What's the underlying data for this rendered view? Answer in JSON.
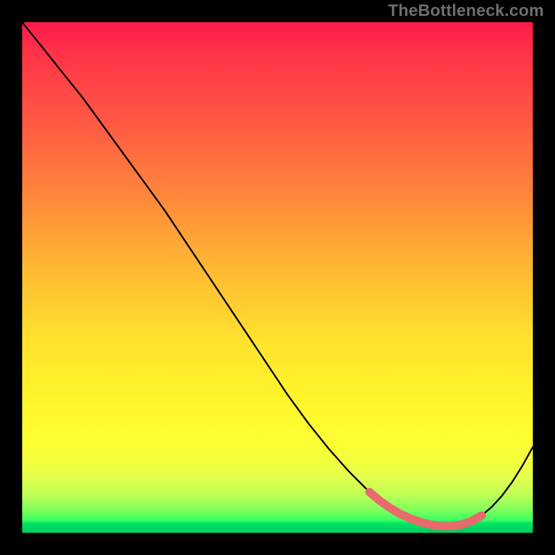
{
  "watermark": "TheBottleneck.com",
  "colors": {
    "curve": "#000000",
    "highlight": "#e86a6d",
    "gradient_top": "#ff1a4d",
    "gradient_bottom": "#00c85f"
  },
  "chart_data": {
    "type": "line",
    "title": "",
    "xlabel": "",
    "ylabel": "",
    "xlim": [
      0,
      100
    ],
    "ylim": [
      0,
      100
    ],
    "series": [
      {
        "name": "bottleneck-curve",
        "x": [
          0,
          4,
          8,
          12,
          16,
          20,
          24,
          28,
          32,
          36,
          40,
          44,
          48,
          52,
          56,
          60,
          64,
          68,
          70,
          72,
          74,
          76,
          78,
          80,
          82,
          84,
          86,
          88,
          90,
          92,
          94,
          96,
          98,
          100
        ],
        "y": [
          100,
          95,
          90,
          85,
          79.5,
          74,
          68.5,
          63,
          57,
          51,
          45,
          39,
          33,
          27,
          21.5,
          16.5,
          12,
          8,
          6.3,
          4.9,
          3.7,
          2.8,
          2.1,
          1.6,
          1.3,
          1.3,
          1.6,
          2.3,
          3.4,
          5.1,
          7.3,
          10.0,
          13.2,
          16.8
        ]
      }
    ],
    "highlight_range": {
      "name": "optimal-range",
      "x": [
        68,
        70,
        72,
        74,
        76,
        78,
        80,
        82,
        84,
        86,
        88,
        90
      ],
      "y": [
        8,
        6.3,
        4.9,
        3.7,
        2.8,
        2.1,
        1.6,
        1.3,
        1.3,
        1.6,
        2.3,
        3.4
      ]
    }
  }
}
